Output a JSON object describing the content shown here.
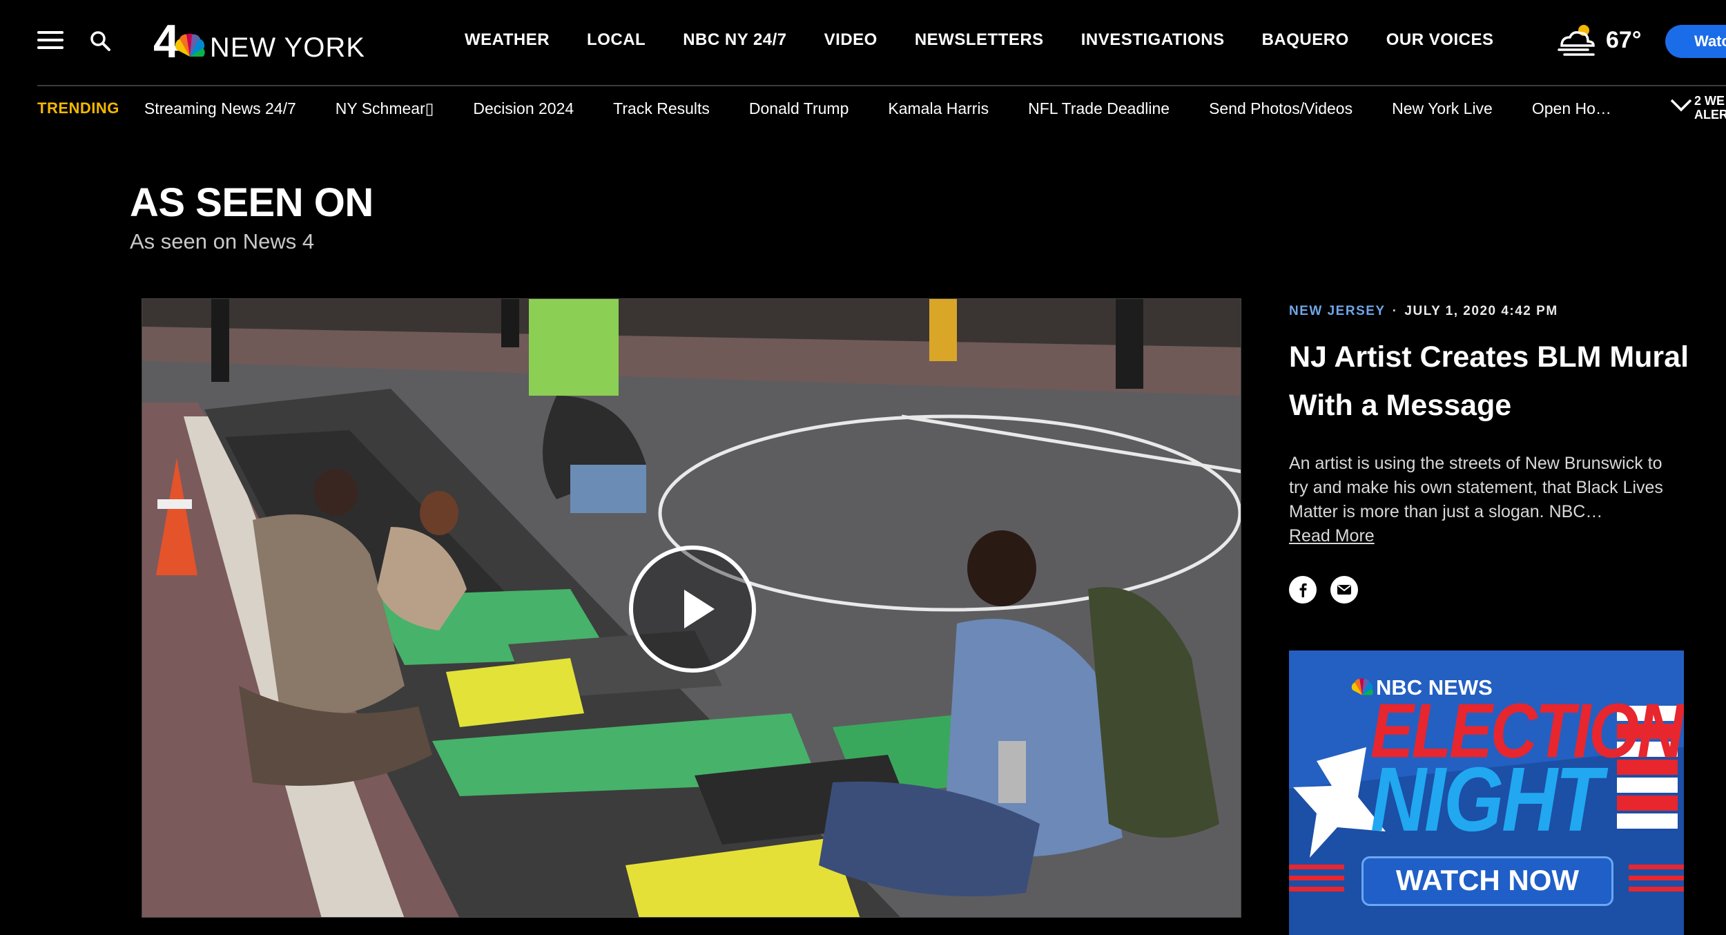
{
  "header": {
    "logo_number": "4",
    "logo_text": "NEW YORK",
    "nav": [
      "WEATHER",
      "LOCAL",
      "NBC NY 24/7",
      "VIDEO",
      "NEWSLETTERS",
      "INVESTIGATIONS",
      "BAQUERO",
      "OUR VOICES"
    ],
    "weather": {
      "temp": "67°",
      "icon": "partly-cloudy-fog-icon"
    },
    "watch_label": "Watc"
  },
  "trending": {
    "label": "TRENDING",
    "items": [
      "Streaming News 24/7",
      "NY Schmear▯",
      "Decision 2024",
      "Track Results",
      "Donald Trump",
      "Kamala Harris",
      "NFL Trade Deadline",
      "Send Photos/Videos",
      "New York Live",
      "Open Ho…"
    ],
    "alerts_line1": "2 WE",
    "alerts_line2": "ALER"
  },
  "section": {
    "title": "AS SEEN ON",
    "subtitle": "As seen on News 4"
  },
  "article": {
    "category": "NEW JERSEY",
    "separator": "·",
    "date": "JULY 1, 2020 4:42 PM",
    "headline": "NJ Artist Creates BLM Mural With a Message",
    "summary": "An artist is using the streets of New Brunswick to try and make his own statement, that Black Lives Matter is more than just a slogan. NBC…",
    "read_more": "Read More",
    "share": [
      "facebook-icon",
      "email-icon"
    ]
  },
  "promo": {
    "brand": "NBC NEWS",
    "line1": "ELECTION",
    "line2": "NIGHT",
    "cta": "WATCH NOW"
  },
  "colors": {
    "background": "#000000",
    "trending_label": "#f5b800",
    "category": "#6fa6e8",
    "watch_button": "#1b6ce8",
    "promo_bg": "#1c4fa6",
    "promo_red": "#e8262e",
    "promo_cyan": "#21a8f0"
  }
}
